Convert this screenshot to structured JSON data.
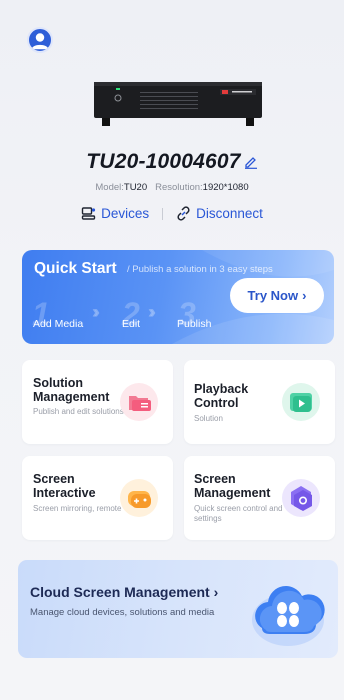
{
  "header": {
    "avatar_icon": "user-icon"
  },
  "device": {
    "name": "TU20-10004607",
    "model_label": "Model:",
    "model_value": "TU20",
    "resolution_label": "Resolution:",
    "resolution_value": "1920*1080",
    "devices_label": "Devices",
    "disconnect_label": "Disconnect"
  },
  "quick_start": {
    "title": "Quick Start",
    "subtitle": "/ Publish a solution in 3 easy steps",
    "button_label": "Try Now",
    "steps": [
      {
        "number": "1",
        "label": "Add Media"
      },
      {
        "number": "2",
        "label": "Edit"
      },
      {
        "number": "3",
        "label": "Publish"
      }
    ]
  },
  "cards": [
    {
      "title": "Solution Management",
      "desc": "Publish and edit solutions",
      "icon": "folder-icon"
    },
    {
      "title": "Playback Control",
      "desc": "Solution",
      "icon": "play-icon"
    },
    {
      "title": "Screen Interactive",
      "desc": "Screen mirroring, remote",
      "icon": "gamepad-icon"
    },
    {
      "title": "Screen Management",
      "desc": "Quick screen control and settings",
      "icon": "settings-hex-icon"
    }
  ],
  "cloud": {
    "title": "Cloud Screen Management",
    "desc": "Manage cloud devices, solutions and media"
  },
  "colors": {
    "accent": "#2a57d6",
    "quick_start_bg": "#4f8af3",
    "cloud_bg": "#d3e1fb"
  }
}
